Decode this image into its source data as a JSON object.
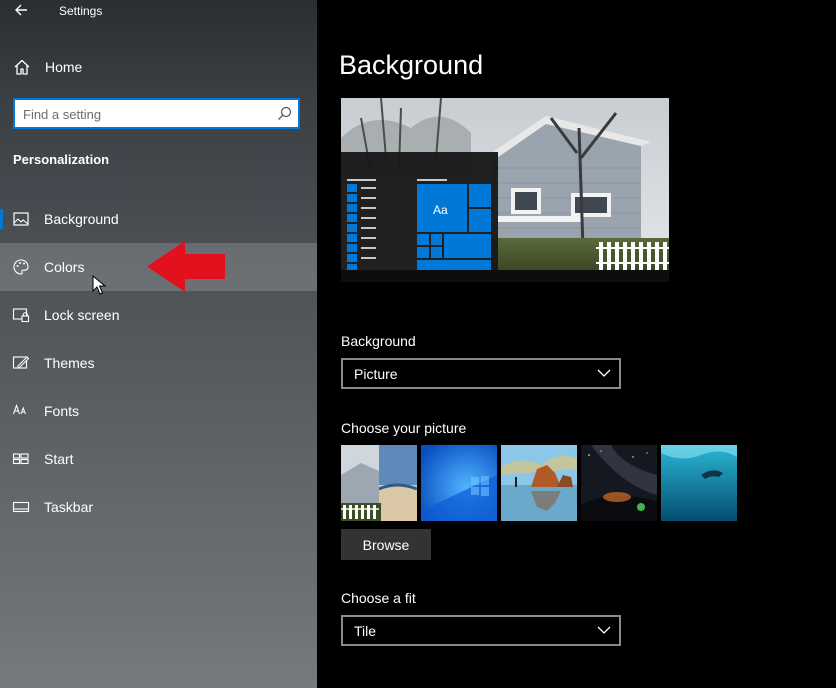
{
  "window": {
    "title": "Settings",
    "back_icon": "back-arrow-icon"
  },
  "sidebar": {
    "home_label": "Home",
    "search": {
      "placeholder": "Find a setting",
      "value": ""
    },
    "section_title": "Personalization",
    "items": [
      {
        "label": "Background",
        "icon": "picture-icon",
        "active": true
      },
      {
        "label": "Colors",
        "icon": "palette-icon",
        "hover": true
      },
      {
        "label": "Lock screen",
        "icon": "lock-screen-icon"
      },
      {
        "label": "Themes",
        "icon": "themes-icon"
      },
      {
        "label": "Fonts",
        "icon": "fonts-icon"
      },
      {
        "label": "Start",
        "icon": "start-icon"
      },
      {
        "label": "Taskbar",
        "icon": "taskbar-icon"
      }
    ]
  },
  "main": {
    "title": "Background",
    "preview_tile_text": "Aa",
    "background_label": "Background",
    "background_value": "Picture",
    "choose_picture_label": "Choose your picture",
    "browse_label": "Browse",
    "fit_label": "Choose a fit",
    "fit_value": "Tile"
  },
  "colors": {
    "accent": "#0078d7",
    "annotation_arrow": "#e3101d",
    "main_bg": "#000000"
  }
}
